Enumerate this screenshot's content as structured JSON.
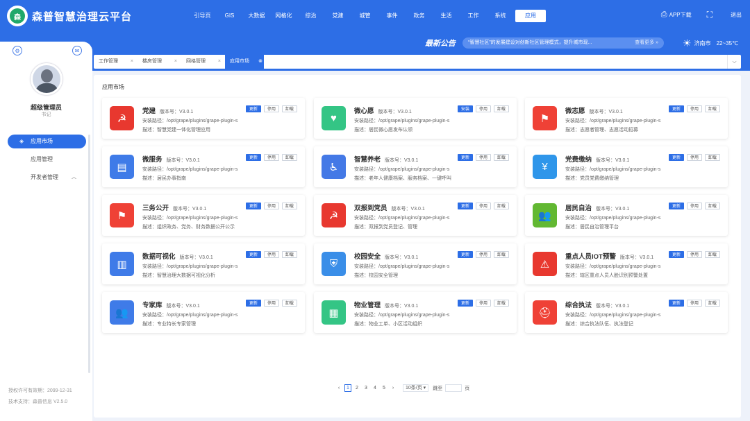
{
  "header": {
    "app_title": "森普智慧治理云平台",
    "logo_text": "森",
    "nav": [
      {
        "label": "引导页",
        "icon": ""
      },
      {
        "label": "GIS"
      },
      {
        "label": "大数据"
      },
      {
        "label": "网格化"
      },
      {
        "label": "综治"
      },
      {
        "label": "党建"
      },
      {
        "label": "城管"
      },
      {
        "label": "事件"
      },
      {
        "label": "政务"
      },
      {
        "label": "生活"
      },
      {
        "label": "工作"
      },
      {
        "label": "系统"
      },
      {
        "label": "应用"
      }
    ],
    "active_nav": "应用",
    "app_download": "APP下载",
    "logout": "退出"
  },
  "bulletin": {
    "title": "最新公告",
    "text": "“智慧社区”的发展建设对创新社区管理模式，提升城市现...",
    "more": "查看更多 »"
  },
  "weather": {
    "city": "济南市",
    "temp": "22~35℃"
  },
  "sidebar": {
    "user_name": "超级管理员",
    "user_role": "书记",
    "menu": [
      {
        "label": "应用市场",
        "active": true
      },
      {
        "label": "应用管理",
        "active": false
      },
      {
        "label": "开发者管理",
        "active": false
      }
    ],
    "license": "授权许可有效期：2099-12-31",
    "support": "技术支持：森普信息  V2.5.0"
  },
  "tabs": [
    {
      "label": "工作管理"
    },
    {
      "label": "楼房管理"
    },
    {
      "label": "网格管理"
    },
    {
      "label": "应用市场"
    }
  ],
  "main": {
    "title": "应用市场"
  },
  "labels": {
    "version_prefix": "版本号：",
    "path_prefix": "安装路径：",
    "desc_prefix": "描述：",
    "btn_update": "更新",
    "btn_install": "安装",
    "btn_disable": "停用",
    "btn_uninstall": "卸载"
  },
  "apps": [
    {
      "name": "党建",
      "version": "V3.0.1",
      "path": "/opt/grape/plugins/grape-plugin-s",
      "desc": "智慧党建一体化管理应用",
      "action": "更新",
      "color": "#e8382f",
      "icon": "party-emblem-icon",
      "glyph": "☭"
    },
    {
      "name": "微心愿",
      "version": "V3.0.1",
      "path": "/opt/grape/plugins/grape-plugin-s",
      "desc": "居民微心愿发布认领",
      "action": "安装",
      "color": "#34c585",
      "icon": "heart-icon",
      "glyph": "♥"
    },
    {
      "name": "微志愿",
      "version": "V3.0.1",
      "path": "/opt/grape/plugins/grape-plugin-s",
      "desc": "志愿者管理、志愿活动招募",
      "action": "更新",
      "color": "#ef4136",
      "icon": "flag-icon",
      "glyph": "⚑"
    },
    {
      "name": "微服务",
      "version": "V3.0.1",
      "path": "/opt/grape/plugins/grape-plugin-s",
      "desc": "居民办事指南",
      "action": "更新",
      "color": "#3f7be8",
      "icon": "folder-icon",
      "glyph": "▤"
    },
    {
      "name": "智慧养老",
      "version": "V3.0.1",
      "path": "/opt/grape/plugins/grape-plugin-s",
      "desc": "老年人健康档案、服务档案、一键呼叫",
      "action": "更新",
      "color": "#4479e6",
      "icon": "elderly-icon",
      "glyph": "♿"
    },
    {
      "name": "党费缴纳",
      "version": "V3.0.1",
      "path": "/opt/grape/plugins/grape-plugin-s",
      "desc": "党员党费缴纳管理",
      "action": "更新",
      "color": "#2f96ea",
      "icon": "payment-icon",
      "glyph": "¥"
    },
    {
      "name": "三务公开",
      "version": "V3.0.1",
      "path": "/opt/grape/plugins/grape-plugin-s",
      "desc": "组织政务、党务、财务数据公开公示",
      "action": "更新",
      "color": "#ef4136",
      "icon": "flag-icon",
      "glyph": "⚑"
    },
    {
      "name": "双报到党员",
      "version": "V3.0.1",
      "path": "/opt/grape/plugins/grape-plugin-s",
      "desc": "双报到党员登记、管理",
      "action": "更新",
      "color": "#e8382f",
      "icon": "party-emblem-icon",
      "glyph": "☭"
    },
    {
      "name": "居民自治",
      "version": "V3.0.1",
      "path": "/opt/grape/plugins/grape-plugin-s",
      "desc": "居民自治管理平台",
      "action": "更新",
      "color": "#62b832",
      "icon": "people-icon",
      "glyph": "👥"
    },
    {
      "name": "数据可视化",
      "version": "V3.0.1",
      "path": "/opt/grape/plugins/grape-plugin-s",
      "desc": "智慧治理大数据可视化分析",
      "action": "更新",
      "color": "#3f7be8",
      "icon": "bar-chart-icon",
      "glyph": "▥"
    },
    {
      "name": "校园安全",
      "version": "V3.0.1",
      "path": "/opt/grape/plugins/grape-plugin-s",
      "desc": "校园安全管理",
      "action": "更新",
      "color": "#3a8ee8",
      "icon": "shield-icon",
      "glyph": "⛨"
    },
    {
      "name": "重点人员IOT预警",
      "version": "V3.0.1",
      "path": "/opt/grape/plugins/grape-plugin-s",
      "desc": "辖区重点人员人脸识别预警处置",
      "action": "更新",
      "color": "#e8382f",
      "icon": "warning-icon",
      "glyph": "⚠"
    },
    {
      "name": "专家库",
      "version": "V3.0.1",
      "path": "/opt/grape/plugins/grape-plugin-s",
      "desc": "专业特长专家管理",
      "action": "更新",
      "color": "#3f7be8",
      "icon": "users-icon",
      "glyph": "👥"
    },
    {
      "name": "物业管理",
      "version": "V3.0.1",
      "path": "/opt/grape/plugins/grape-plugin-s",
      "desc": "物业工单、小区活动组织",
      "action": "更新",
      "color": "#34c585",
      "icon": "building-icon",
      "glyph": "▦"
    },
    {
      "name": "综合执法",
      "version": "V3.0.1",
      "path": "/opt/grape/plugins/grape-plugin-s",
      "desc": "综合执法队伍、执法登记",
      "action": "更新",
      "color": "#ef4136",
      "icon": "police-cap-icon",
      "glyph": "⛑"
    }
  ],
  "pager": {
    "prev": "‹",
    "pages": [
      "1",
      "2",
      "3",
      "4",
      "5"
    ],
    "current": "1",
    "next": "›",
    "page_size": "10条/页 ▾",
    "goto": "跳至",
    "page_unit": "页"
  }
}
